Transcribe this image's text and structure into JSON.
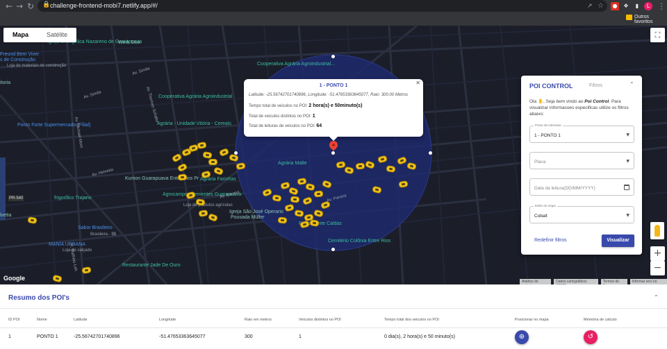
{
  "browser": {
    "url": "challenge-frontend-mobi7.netlify.app/#/",
    "bookmark_label": "Outros favoritos",
    "profile_initial": "L"
  },
  "map": {
    "type_tabs": [
      "Mapa",
      "Satélite"
    ],
    "google_label": "Google",
    "attribution": [
      "Atalhos do teclado",
      "Dados cartográficos ©2022",
      "Termos de Uso",
      "Informar erro no mapa"
    ],
    "labels": {
      "igreja_evangelica": "Igreja Evangelica Nazareno de Guarapuava",
      "werk_stok": "Werk Stok",
      "freund_bem_viver": "Freund Bem Viver",
      "de_construcao": "s de Construção",
      "loja_material": "Loja de materiais de construção",
      "itoria": "itoria",
      "coop_agraria_agroindustrial_top": "Cooperativa Agrária Agroindustrial...",
      "coop_agraria_agroindustrial": "Cooperativa Agrária Agroindustrial",
      "ponto_forte": "Ponto Forte Supermercado (Filial)",
      "agraria_unidade": "Agrária - Unidade Vitória - Cereais",
      "agraria_malte": "Agrária Malte",
      "kumon": "Kumon Guarapuava Entre Rios Pr",
      "agraria_farinhas": "Agrária Farinhas",
      "agrocampos": "Agrocampos Sementes Guarapuava",
      "agrocampos_sub": "Loja de produtos agrícolas",
      "frigorifico": "frigorifico Trajano",
      "sabor_brasileiro": "Sabor Brasileiro",
      "sabor_sub": "Brasileira - $$",
      "igreja_sao_jose": "Igreja São José Operario",
      "pousada_muller": "Pousada Müller",
      "restaurante_caldas": "Restaurante Caldas",
      "mania_urbana": "MANIA URBANA",
      "mania_sub": "Loja de calçado",
      "cemiterio": "Cemitério Colônia Entre Rios",
      "restaurante_jade": "Restaurante Jade De Ouro",
      "av_simila_1": "Av. Simila",
      "av_simila_2": "Av. Simila",
      "av_michael_moor": "Av. Michael Moor",
      "av_thomas_schafer": "Av. Thomas Schäfer",
      "av_helvetia": "Av. Helvetia",
      "av_parana": "Av. Parana",
      "av_parana_2": "Av. Parana",
      "rua_mathias": "R. Mathias Leh",
      "pr_540": "PR-540",
      "velvia": "lvetia"
    }
  },
  "info_window": {
    "title": "1 - PONTO 1",
    "coords": "Latitude: -25.56742701740896, Longitude: -51.47653363645077, Raio: 300.00 Metros",
    "time_label": "Tempo total de veiculos no POI:",
    "time_value": "2 hora(s) e 50minuto(s)",
    "distinct_label": "Total de veiculos distintos no POI:",
    "distinct_value": "1",
    "reads_label": "Total de leituras de veiculos no POI:",
    "reads_value": "64"
  },
  "panel": {
    "tab_active": "POI CONTROL",
    "tab_other": "Filtros",
    "intro_pre": "Ola",
    "intro_mid": ", Seja bem vindo ao",
    "intro_brand": "Poi Control",
    "intro_post": ". Para visualizar informacoes especificas utilize os filtros abaixo:",
    "poi_label": "Ponto de Interesse",
    "poi_value": "1 - PONTO 1",
    "plate_placeholder": "Placa",
    "date_placeholder": "Data da leitura(DD/MM/YYYY)",
    "style_label": "Estilo do mapa",
    "style_value": "Cobalt",
    "reset_label": "Redefinir filtros",
    "view_label": "Visualizar"
  },
  "summary": {
    "title": "Resumo dos POI's",
    "columns": [
      "ID POI",
      "Nome",
      "Latitude",
      "Longitude",
      "Raio em metros",
      "Veiculos distintos no POI",
      "Tempo total dos veiculos no POI",
      "Posicionar no mapa",
      "Memória de calculo"
    ],
    "rows": [
      {
        "id": "1",
        "name": "PONTO 1",
        "lat": "-25.56742701740896",
        "lng": "-51.47653363645077",
        "radius": "300",
        "distinct": "1",
        "time": "0 dia(s), 2 hora(s) e 50 minuto(s)"
      }
    ]
  },
  "colors": {
    "accent": "#3949ab",
    "position_btn": "#3949ab",
    "memory_btn": "#e91e63",
    "map_bg": "#1b1e29",
    "circle": "#1f2a6e"
  }
}
